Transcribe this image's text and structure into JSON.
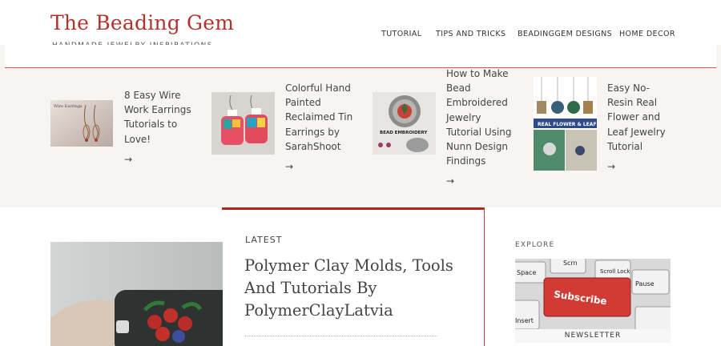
{
  "header": {
    "site_title": "The Beading Gem",
    "tagline": "HANDMADE JEWELRY INSPIRATIONS",
    "nav": [
      {
        "label": "TUTORIAL"
      },
      {
        "label": "TIPS AND TRICKS"
      },
      {
        "label": "BEADINGGEM DESIGNS"
      },
      {
        "label": "HOME DECOR"
      }
    ]
  },
  "featured": [
    {
      "title": "8 Easy Wire Work Earrings Tutorials to Love!",
      "arrow": "→",
      "thumb_text": "Wire Earrings"
    },
    {
      "title": "Colorful Hand Painted Reclaimed Tin Earrings by SarahShoot",
      "arrow": "→"
    },
    {
      "title": "How to Make Bead Embroidered Jewelry Tutorial Using Nunn Design Findings",
      "arrow": "→",
      "thumb_text": "BEAD EMBROIDERY"
    },
    {
      "title": "Easy No-Resin Real Flower and Leaf Jewelry Tutorial",
      "arrow": "→",
      "thumb_text": "REAL FLOWER & LEAF"
    }
  ],
  "main": {
    "label": "LATEST",
    "post_title": "Polymer Clay Molds, Tools And Tutorials By PolymerClayLatvia"
  },
  "sidebar": {
    "heading": "EXPLORE",
    "newsletter_label": "NEWSLETTER",
    "keys": [
      "Space",
      "Scrn",
      "Scroll Lock",
      "Pause",
      "Subscribe",
      "Insert"
    ]
  },
  "colors": {
    "brand": "#b5312b",
    "accent_line": "#b5231d",
    "strip_bg": "#f6f5f2"
  }
}
